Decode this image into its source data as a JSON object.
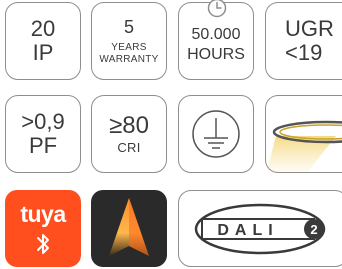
{
  "tiles": {
    "ip": {
      "value": "20",
      "label": "IP"
    },
    "warranty": {
      "value": "5",
      "line1": "YEARS",
      "line2": "WARRANTY"
    },
    "hours": {
      "value": "50.000",
      "label": "HOURS",
      "icon": "clock-icon"
    },
    "ugr": {
      "value": "UGR",
      "label": "<19"
    },
    "pf": {
      "value": ">0,9",
      "label": "PF"
    },
    "cri": {
      "value": "≥80",
      "label": "CRI"
    },
    "ground": {
      "icon": "ground-icon"
    },
    "light": {
      "icon": "ring-light-icon"
    },
    "tuya": {
      "word": "tuya",
      "icon": "bluetooth-icon",
      "color": "#ff4f1f"
    },
    "app": {
      "icon": "app-logo-icon"
    },
    "dali": {
      "logo_text": "DALI",
      "version": "2"
    }
  }
}
